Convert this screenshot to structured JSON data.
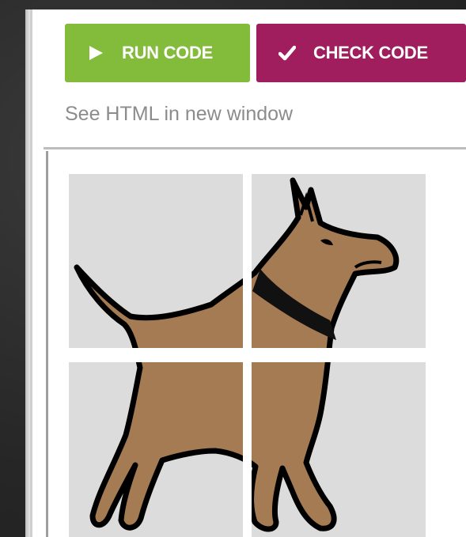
{
  "toolbar": {
    "run_label": "RUN CODE",
    "check_label": "CHECK CODE",
    "run_color": "#82bc3a",
    "check_color": "#a01e5e",
    "run_icon": "play-icon",
    "check_icon": "checkmark-icon"
  },
  "link": {
    "text": "See HTML in new window"
  },
  "output": {
    "image": "dog-puzzle-icon",
    "tile_count": 4
  }
}
